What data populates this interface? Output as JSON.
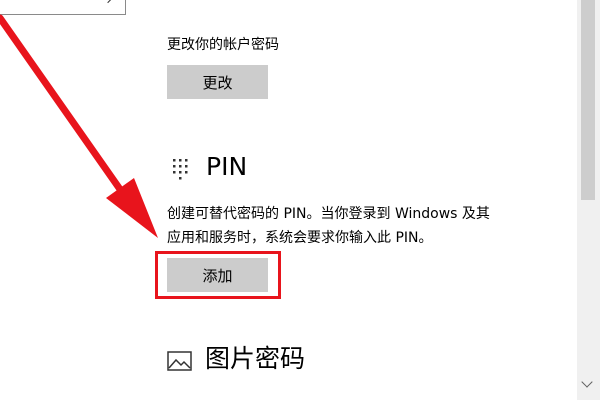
{
  "account_password": {
    "description": "更改你的帐户密码",
    "button_label": "更改"
  },
  "pin": {
    "heading": "PIN",
    "icon": "keypad-icon",
    "description_line1": "创建可替代密码的 PIN。当你登录到 Windows 及其",
    "description_line2": "应用和服务时，系统会要求你输入此 PIN。",
    "button_label": "添加"
  },
  "picture_password": {
    "heading": "图片密码",
    "icon": "picture-icon"
  },
  "annotation": {
    "arrow_color": "#e8141c",
    "highlight_color": "#e8141c"
  },
  "colors": {
    "button_bg": "#cccccc",
    "scrollbar_thumb": "#cdcdcd",
    "scrollbar_track": "#f0f0f0"
  }
}
